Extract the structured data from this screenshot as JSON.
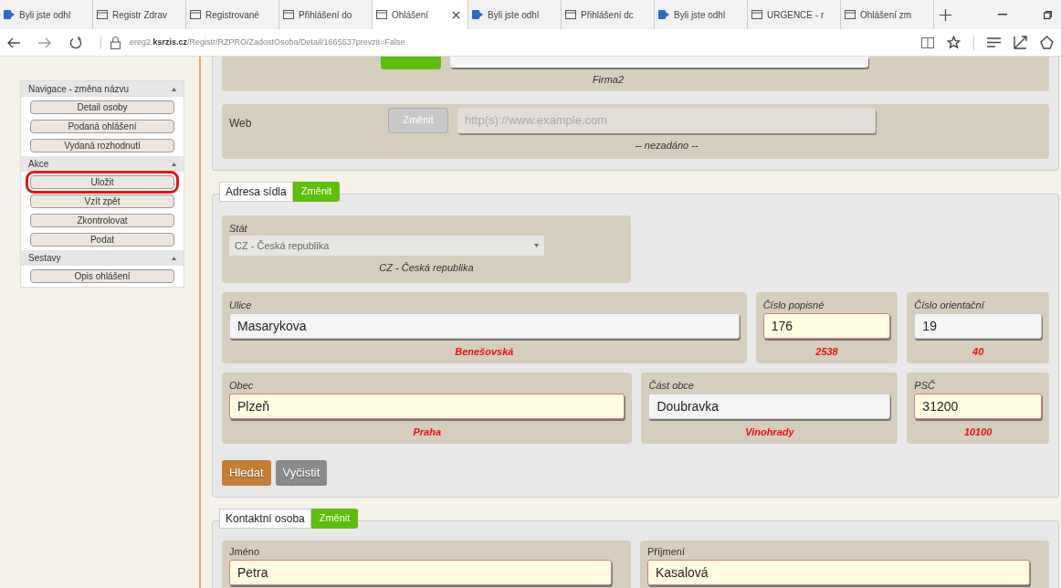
{
  "browser": {
    "tabs": [
      {
        "title": "Byli jste odhl",
        "kind": "site",
        "selected": false
      },
      {
        "title": "Registr Zdrav",
        "kind": "page",
        "selected": false
      },
      {
        "title": "Registrované",
        "kind": "page",
        "selected": false
      },
      {
        "title": "Přihlášení do",
        "kind": "page",
        "selected": false
      },
      {
        "title": "Ohlášení",
        "kind": "page",
        "selected": true
      },
      {
        "title": "Byli jste odhl",
        "kind": "site",
        "selected": false
      },
      {
        "title": "Přihlášení dc",
        "kind": "page",
        "selected": false
      },
      {
        "title": "Byli jste odhl",
        "kind": "site",
        "selected": false
      },
      {
        "title": "URGENCE - r",
        "kind": "page",
        "selected": false
      },
      {
        "title": "Ohlášení zm",
        "kind": "page",
        "selected": false
      }
    ],
    "address": {
      "host_prefix": "ereg2.",
      "host": "ksrzis.cz",
      "path": "/Registr/RZPRO/ZadostOsoba/Detail/1665537prevzit=False"
    }
  },
  "sidebar": {
    "groups": [
      {
        "title": "Navigace - změna názvu",
        "buttons": [
          {
            "label": "Detail osoby",
            "highlighted": false
          },
          {
            "label": "Podaná ohlášení",
            "highlighted": false
          },
          {
            "label": "Vydaná rozhodnutí",
            "highlighted": false
          }
        ]
      },
      {
        "title": "Akce",
        "buttons": [
          {
            "label": "Uložit",
            "highlighted": true
          },
          {
            "label": "Vzít zpět",
            "highlighted": false
          },
          {
            "label": "Zkontrolovat",
            "highlighted": false
          },
          {
            "label": "Podat",
            "highlighted": false
          }
        ]
      },
      {
        "title": "Sestavy",
        "buttons": [
          {
            "label": "Opis ohlášení",
            "highlighted": false
          }
        ]
      }
    ]
  },
  "top_section": {
    "firm_caption": "Firma2",
    "web": {
      "label": "Web",
      "button": "Změnit",
      "button_disabled": true,
      "placeholder": "http(s)://www.example.com",
      "caption": "-- nezadáno --"
    }
  },
  "address_section": {
    "title": "Adresa sídla",
    "button": "Změnit",
    "country": {
      "label": "Stát",
      "value": "CZ - Česká republika",
      "caption": "CZ - Česká republika"
    },
    "rows": [
      [
        {
          "label": "Ulice",
          "value": "Masarykova",
          "changed": false,
          "previous": "Benešovská"
        },
        {
          "label": "Číslo popisné",
          "value": "176",
          "changed": true,
          "previous": "2538"
        },
        {
          "label": "Číslo orientační",
          "value": "19",
          "changed": false,
          "previous": "40"
        }
      ],
      [
        {
          "label": "Obec",
          "value": "Plzeň",
          "changed": true,
          "previous": "Praha"
        },
        {
          "label": "Část obce",
          "value": "Doubravka",
          "changed": false,
          "previous": "Vinohrady"
        },
        {
          "label": "PSČ",
          "value": "31200",
          "changed": true,
          "previous": "10100"
        }
      ]
    ],
    "actions": [
      {
        "label": "Hledat",
        "kind": "primary"
      },
      {
        "label": "Vyčistit",
        "kind": "secondary"
      }
    ]
  },
  "contact_section": {
    "title": "Kontaktní osoba",
    "button": "Změnit",
    "fields": [
      {
        "label": "Jméno",
        "value": "Petra",
        "changed": true
      },
      {
        "label": "Příjmení",
        "value": "Kasalová",
        "changed": true
      }
    ]
  }
}
